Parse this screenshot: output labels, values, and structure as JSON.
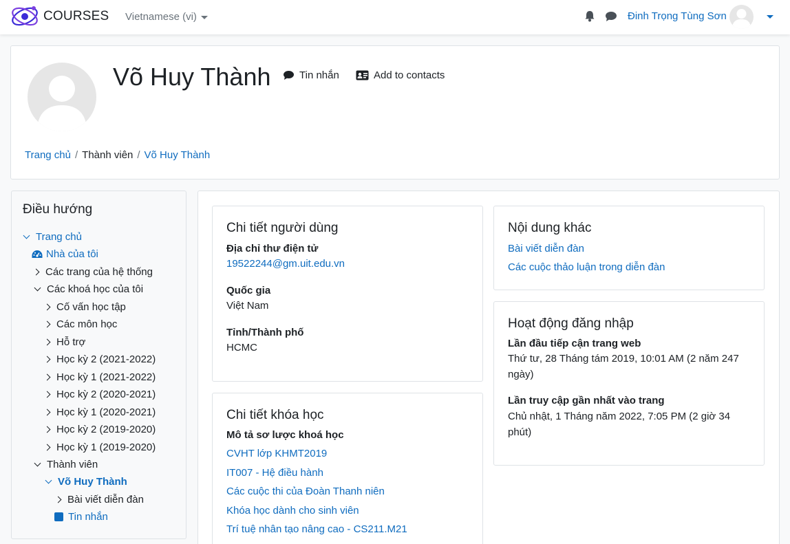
{
  "navbar": {
    "brand": "COURSES",
    "language": "Vietnamese (vi)",
    "username": "Đinh Trọng Tùng Sơn",
    "notifications_icon": "bell-icon",
    "messages_icon": "chat-icon"
  },
  "profile": {
    "name": "Võ Huy Thành",
    "message_label": "Tin nhắn",
    "add_contact_label": "Add to contacts"
  },
  "breadcrumb": [
    "Trang chủ",
    "Thành viên",
    "Võ Huy Thành"
  ],
  "navigation": {
    "title": "Điều hướng",
    "items": [
      {
        "label": "Trang chủ"
      },
      {
        "label": "Nhà của tôi"
      },
      {
        "label": "Các trang của hệ thống"
      },
      {
        "label": "Các khoá học của tôi"
      },
      {
        "label": "Cố vấn học tập"
      },
      {
        "label": "Các môn học"
      },
      {
        "label": "Hỗ trợ"
      },
      {
        "label": "Học kỳ 2 (2021-2022)"
      },
      {
        "label": "Học kỳ 1 (2021-2022)"
      },
      {
        "label": "Học kỳ 2 (2020-2021)"
      },
      {
        "label": "Học kỳ 1 (2020-2021)"
      },
      {
        "label": "Học kỳ 2 (2019-2020)"
      },
      {
        "label": "Học kỳ 1 (2019-2020)"
      },
      {
        "label": "Thành viên"
      },
      {
        "label": "Võ Huy Thành"
      },
      {
        "label": "Bài viết diễn đàn"
      },
      {
        "label": "Tin nhắn"
      }
    ]
  },
  "user_details": {
    "title": "Chi tiết người dùng",
    "email_label": "Địa chỉ thư điện tử",
    "email": "19522244@gm.uit.edu.vn",
    "country_label": "Quốc gia",
    "country": "Việt Nam",
    "city_label": "Tỉnh/Thành phố",
    "city": "HCMC"
  },
  "course_details": {
    "title": "Chi tiết khóa học",
    "profiles_label": "Mô tả sơ lược khoá học",
    "courses": [
      "CVHT lớp KHMT2019",
      "IT007 - Hệ điều hành",
      "Các cuộc thi của Đoàn Thanh niên",
      "Khóa học dành cho sinh viên",
      "Trí tuệ nhân tạo nâng cao - CS211.M21"
    ]
  },
  "misc": {
    "title": "Nội dung khác",
    "links": [
      "Bài viết diễn đàn",
      "Các cuộc thảo luận trong diễn đàn"
    ]
  },
  "login_activity": {
    "title": "Hoạt động đăng nhập",
    "first_access_label": "Lần đầu tiếp cận trang web",
    "first_access_line1": "Thứ tư, 28 Tháng tám 2019, 10:01 AM  (2 năm 247",
    "first_access_line2": "ngày)",
    "last_access_label": "Lần truy cập gần nhất vào trang",
    "last_access_line1": "Chủ nhật, 1 Tháng năm 2022, 7:05 PM  (2 giờ 34",
    "last_access_line2": "phút)"
  },
  "colors": {
    "link": "#0f6cbf",
    "text": "#1d2125",
    "border": "#dee2e6"
  }
}
